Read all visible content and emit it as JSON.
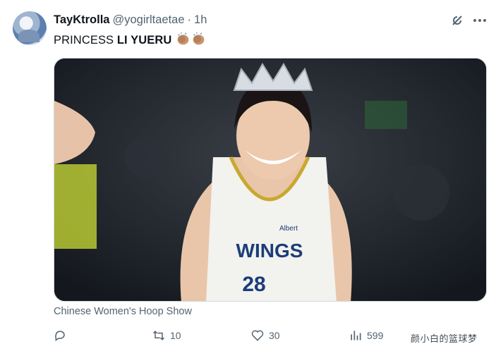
{
  "author": {
    "display_name": "TayKtrolla",
    "handle": "@yogirltaetae",
    "separator": "·",
    "time": "1h",
    "avatar_icon": "profile-avatar"
  },
  "tweet": {
    "text_prefix": "PRINCESS ",
    "text_bold": "LI YUERU",
    "emoji": [
      "clapping-hands-medium-skin-tone",
      "clapping-hands-medium-skin-tone"
    ]
  },
  "media": {
    "description_icon": "photo",
    "jersey_brand": "WINGS",
    "jersey_number": "28",
    "sponsor": "Albert"
  },
  "source_label": "Chinese Women's Hoop Show",
  "actions": {
    "reply_count": "",
    "retweet_count": "10",
    "like_count": "30",
    "view_count": "599"
  },
  "watermark": "颜小白的篮球梦",
  "colors": {
    "text": "#0f1419",
    "secondary": "#536471",
    "border": "#cfd9de"
  }
}
